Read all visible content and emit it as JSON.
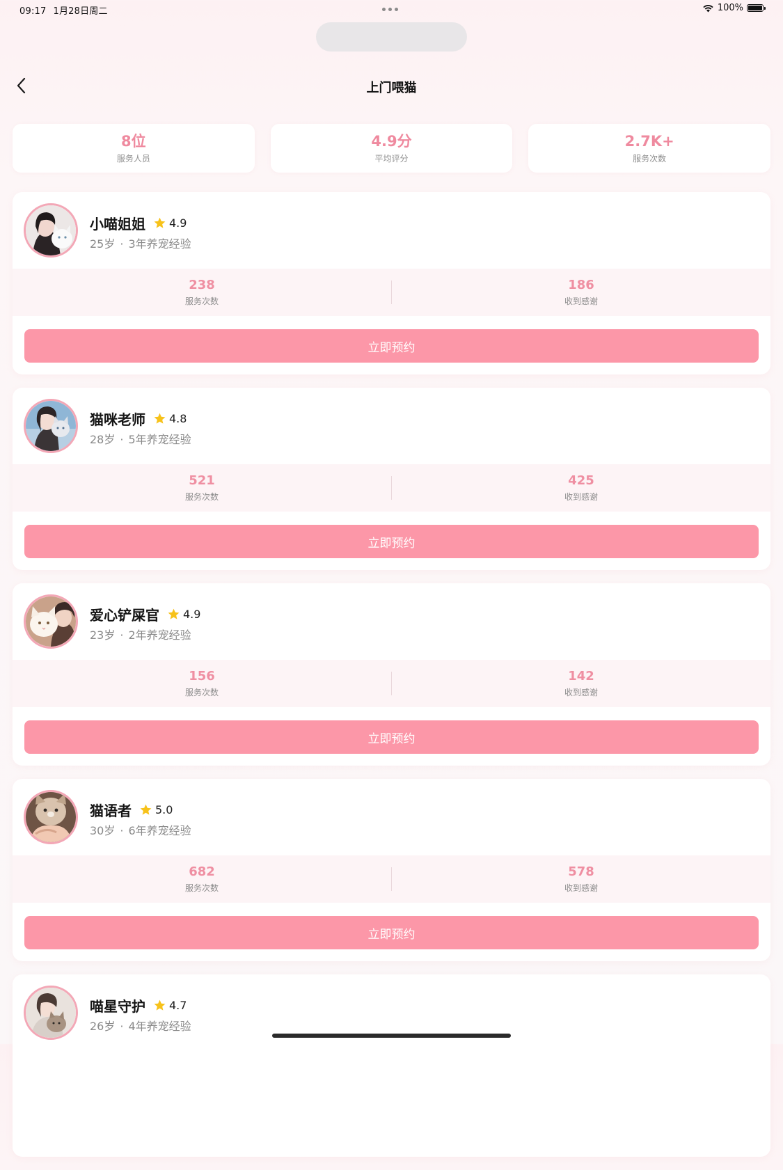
{
  "status_bar": {
    "time": "09:17",
    "date": "1月28日周二",
    "battery": "100%"
  },
  "header": {
    "title": "上门喂猫"
  },
  "summary": [
    {
      "value": "8位",
      "label": "服务人员"
    },
    {
      "value": "4.9分",
      "label": "平均评分"
    },
    {
      "value": "2.7K+",
      "label": "服务次数"
    }
  ],
  "staff": [
    {
      "name": "小喵姐姐",
      "rating": "4.9",
      "age": "25岁",
      "experience": "3年养宠经验",
      "services": "238",
      "services_label": "服务次数",
      "thanks": "186",
      "thanks_label": "收到感谢",
      "book_label": "立即预约"
    },
    {
      "name": "猫咪老师",
      "rating": "4.8",
      "age": "28岁",
      "experience": "5年养宠经验",
      "services": "521",
      "services_label": "服务次数",
      "thanks": "425",
      "thanks_label": "收到感谢",
      "book_label": "立即预约"
    },
    {
      "name": "爱心铲屎官",
      "rating": "4.9",
      "age": "23岁",
      "experience": "2年养宠经验",
      "services": "156",
      "services_label": "服务次数",
      "thanks": "142",
      "thanks_label": "收到感谢",
      "book_label": "立即预约"
    },
    {
      "name": "猫语者",
      "rating": "5.0",
      "age": "30岁",
      "experience": "6年养宠经验",
      "services": "682",
      "services_label": "服务次数",
      "thanks": "578",
      "thanks_label": "收到感谢",
      "book_label": "立即预约"
    },
    {
      "name": "喵星守护",
      "rating": "4.7",
      "age": "26岁",
      "experience": "4年养宠经验",
      "services": "",
      "services_label": "",
      "thanks": "",
      "thanks_label": "",
      "book_label": ""
    }
  ],
  "icons": {
    "back": "chevron-left-icon",
    "rating": "star-icon",
    "wifi": "wifi-icon",
    "battery": "battery-icon"
  },
  "colors": {
    "accent": "#fc97a8",
    "stat_value": "#ef8fa2",
    "star": "#f7c21a",
    "avatar_border": "#f3a7b6"
  }
}
